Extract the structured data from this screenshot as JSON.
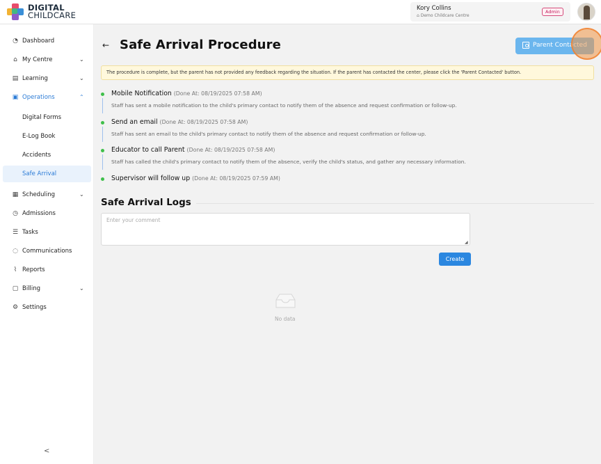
{
  "brand": {
    "line1": "DIGITAL",
    "line2": "CHILDCARE"
  },
  "user": {
    "name": "Kory Collins",
    "centre": "Demo Childcare Centre",
    "role": "Admin"
  },
  "sidebar": {
    "items": [
      {
        "label": "Dashboard",
        "icon": "dashboard-icon"
      },
      {
        "label": "My Centre",
        "icon": "home-icon"
      },
      {
        "label": "Learning",
        "icon": "book-icon"
      },
      {
        "label": "Operations",
        "icon": "operations-icon"
      },
      {
        "label": "Scheduling",
        "icon": "calendar-icon"
      },
      {
        "label": "Admissions",
        "icon": "admissions-icon"
      },
      {
        "label": "Tasks",
        "icon": "tasks-icon"
      },
      {
        "label": "Communications",
        "icon": "chat-icon"
      },
      {
        "label": "Reports",
        "icon": "chart-icon"
      },
      {
        "label": "Billing",
        "icon": "billing-icon"
      },
      {
        "label": "Settings",
        "icon": "gear-icon"
      }
    ],
    "operations_sub": [
      {
        "label": "Digital Forms"
      },
      {
        "label": "E-Log Book"
      },
      {
        "label": "Accidents"
      },
      {
        "label": "Safe Arrival"
      }
    ],
    "collapse_label": "<"
  },
  "page": {
    "title": "Safe Arrival Procedure",
    "parent_contacted_label": "Parent Contacted",
    "alert": "The procedure is complete, but the parent has not provided any feedback regarding the situation. If the parent has contacted the center, please click the 'Parent Contacted' button."
  },
  "steps": [
    {
      "title": "Mobile Notification",
      "done": "(Done At: 08/19/2025 07:58 AM)",
      "desc": "Staff has sent a mobile notification to the child's primary contact to notify them of the absence and request confirmation or follow-up."
    },
    {
      "title": "Send an email",
      "done": "(Done At: 08/19/2025 07:58 AM)",
      "desc": "Staff has sent an email to the child's primary contact to notify them of the absence and request confirmation or follow-up."
    },
    {
      "title": "Educator to call Parent",
      "done": "(Done At: 08/19/2025 07:58 AM)",
      "desc": "Staff has called the child's primary contact to notify them of the absence, verify the child's status, and gather any necessary information."
    },
    {
      "title": "Supervisor will follow up",
      "done": "(Done At: 08/19/2025 07:59 AM)",
      "desc": ""
    }
  ],
  "logs": {
    "title": "Safe Arrival Logs",
    "comment_placeholder": "Enter your comment",
    "create_label": "Create",
    "empty_text": "No data"
  },
  "colors": {
    "accent": "#2b87e0",
    "success": "#3fbf4a",
    "alert_bg": "#fff8dc"
  }
}
